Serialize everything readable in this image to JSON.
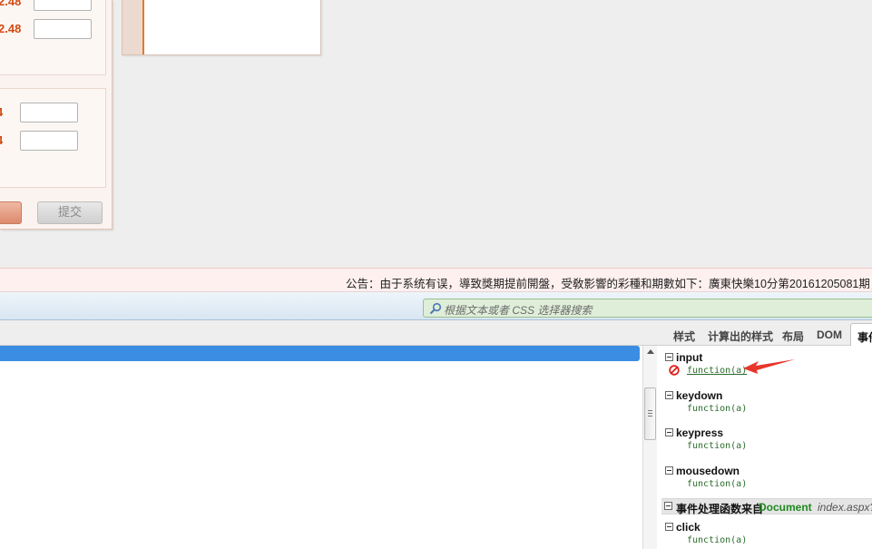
{
  "webpage": {
    "odds": [
      "2.48",
      "2.48",
      "4",
      "4"
    ],
    "buttons": {
      "submit_label": "提交"
    },
    "notice": "公告：由于系统有误，導致獎期提前開盤，受敎影響的彩種和期數如下：廣東快樂10分第20161205081期；"
  },
  "devtools": {
    "search": {
      "placeholder": "根据文本或者 CSS 选择器搜索"
    },
    "tabs": [
      "样式",
      "计算出的样式",
      "布局",
      "DOM",
      "事件"
    ],
    "events": [
      {
        "name": "input",
        "handler": "function(a)"
      },
      {
        "name": "keydown",
        "handler": "function(a)"
      },
      {
        "name": "keypress",
        "handler": "function(a)"
      },
      {
        "name": "mousedown",
        "handler": "function(a)"
      }
    ],
    "document_section": {
      "label": "事件处理函数来自",
      "source": "Document",
      "file": "index.aspx?I"
    },
    "document_events": [
      {
        "name": "click",
        "handler": "function(a)"
      }
    ]
  },
  "colors": {
    "odds_red": "#d24a12",
    "selection_blue": "#3a8de3",
    "handler_green": "#2a6b2a",
    "annotation_arrow": "#e8352a"
  },
  "icons": [
    "search-icon",
    "no-entry-icon",
    "collapse-toggle-icon",
    "scroll-up-icon",
    "annotation-arrow"
  ]
}
